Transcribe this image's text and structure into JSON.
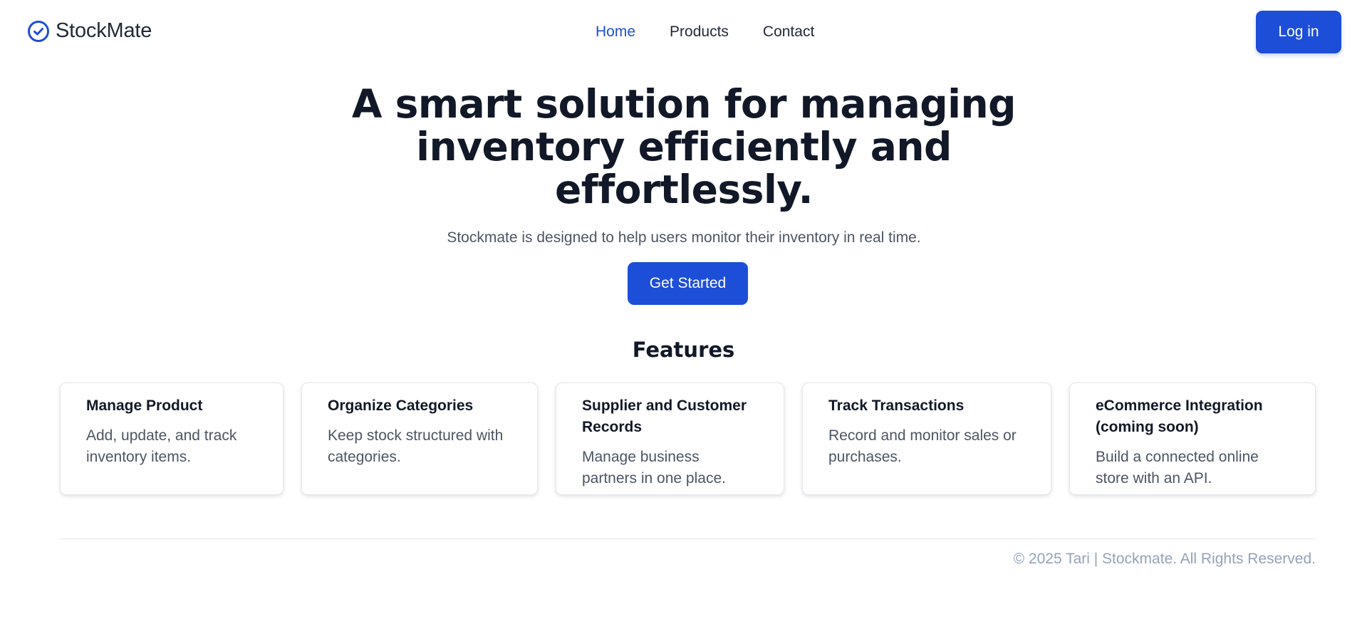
{
  "brand": {
    "name": "StockMate",
    "icon": "check-circle-icon",
    "accent": "#1d4ed8"
  },
  "nav": {
    "links": [
      {
        "label": "Home",
        "active": true
      },
      {
        "label": "Products",
        "active": false
      },
      {
        "label": "Contact",
        "active": false
      }
    ],
    "login_label": "Log in"
  },
  "hero": {
    "title_lines": [
      "A smart solution for managing",
      "inventory efficiently and",
      "effortlessly."
    ],
    "subtitle": "Stockmate is designed to help users monitor their inventory in real time.",
    "cta_label": "Get Started"
  },
  "features": {
    "title": "Features",
    "items": [
      {
        "title": "Manage Product",
        "description": "Add, update, and track inventory items."
      },
      {
        "title": "Organize Categories",
        "description": "Keep stock structured with categories."
      },
      {
        "title": "Supplier and Customer Records",
        "description": "Manage business partners in one place."
      },
      {
        "title": "Track Transactions",
        "description": "Record and monitor sales or purchases."
      },
      {
        "title": "eCommerce Integration (coming soon)",
        "description": "Build a connected online store with an API."
      }
    ]
  },
  "footer": {
    "copyright": "© 2025 Tari | Stockmate. All Rights Reserved."
  }
}
